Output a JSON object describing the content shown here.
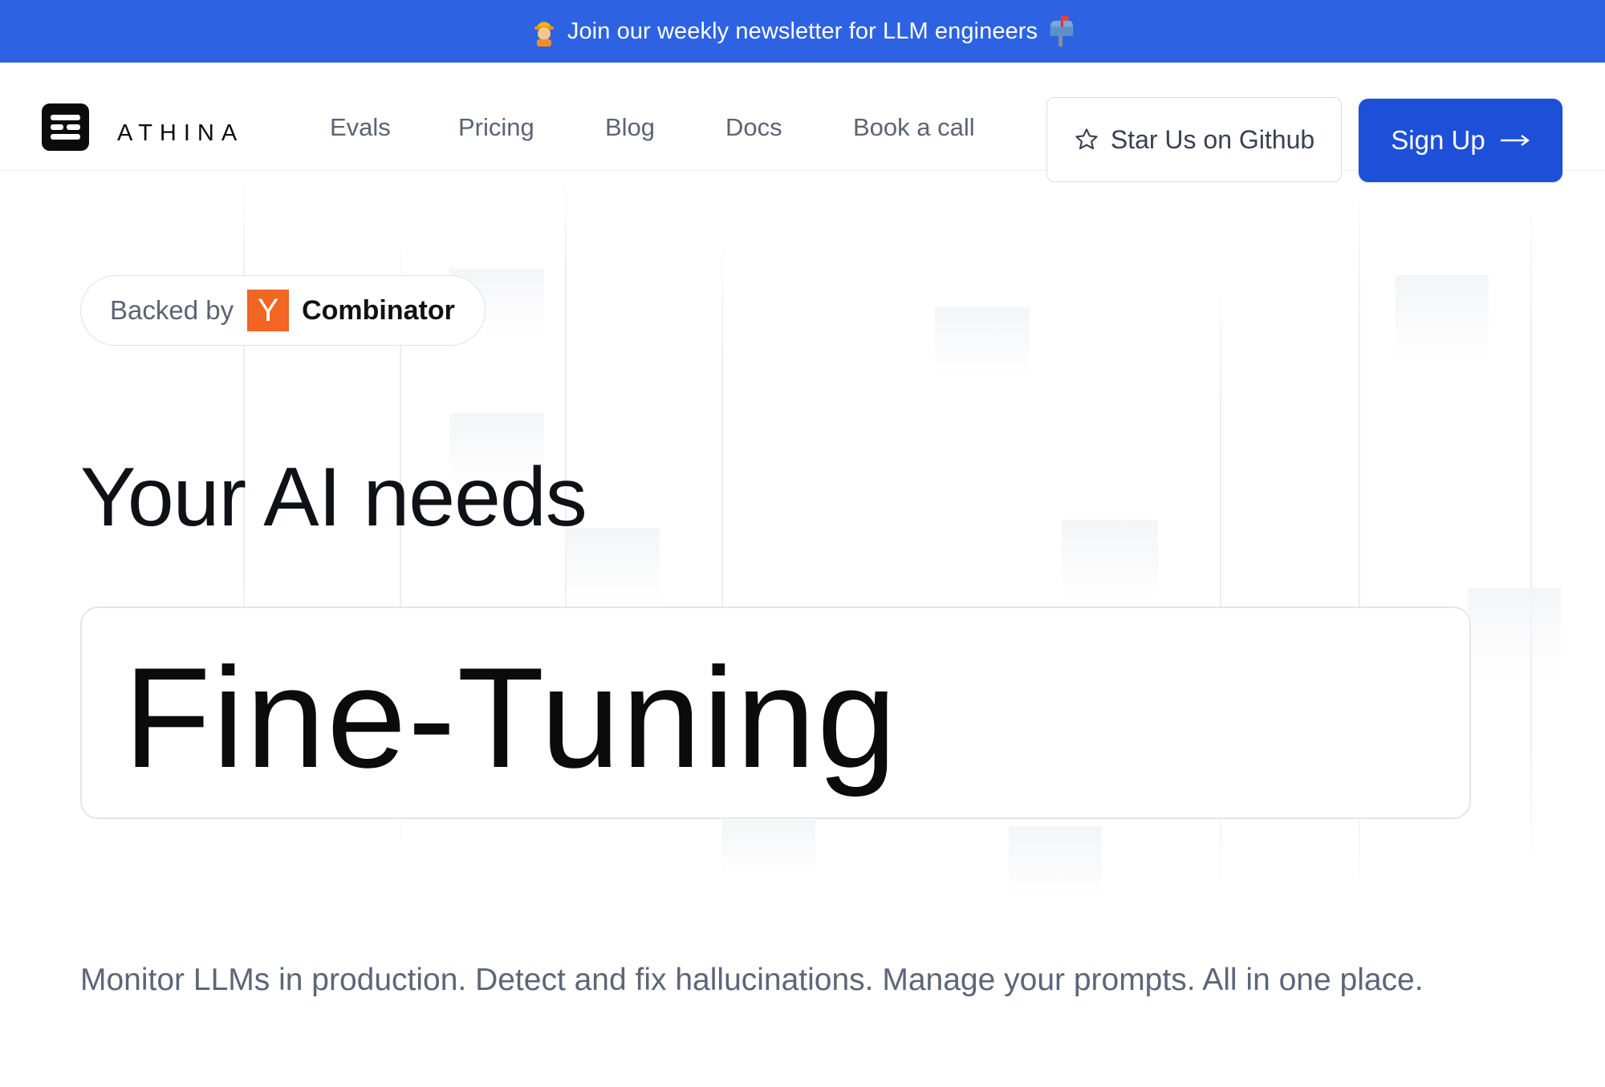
{
  "banner": {
    "text": "Join our weekly newsletter for LLM engineers",
    "left_icon": "construction-worker-emoji-icon",
    "right_icon": "mailbox-emoji-icon",
    "background_color": "#2d63e2"
  },
  "header": {
    "brand": "ATHINA",
    "logo_icon": "athina-logo-icon",
    "nav": [
      "Evals",
      "Pricing",
      "Blog",
      "Docs",
      "Book a call"
    ],
    "github_button": {
      "label": "Star Us on Github",
      "icon": "star-outline-icon"
    },
    "signup_button": {
      "label": "Sign Up",
      "icon": "arrow-right-icon",
      "color": "#1e4fd8"
    }
  },
  "hero": {
    "badge": {
      "prefix": "Backed by",
      "yc_letter": "Y",
      "yc_name": "Combinator",
      "yc_color": "#f26522"
    },
    "heading": "Your AI needs",
    "rotating_word": "Fine-Tuning",
    "subtitle": "Monitor LLMs in production. Detect and fix hallucinations. Manage your prompts. All in one place."
  }
}
